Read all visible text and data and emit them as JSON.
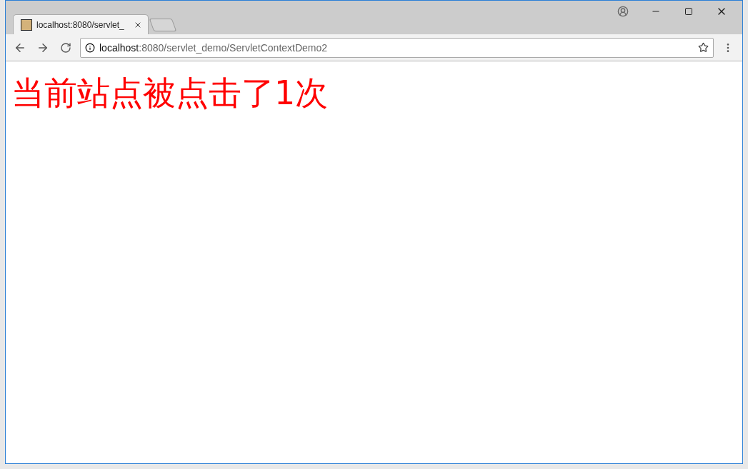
{
  "tabs": [
    {
      "title": "localhost:8080/servlet_",
      "selected": true
    }
  ],
  "address_bar": {
    "host": "localhost",
    "path": ":8080/servlet_demo/ServletContextDemo2"
  },
  "page": {
    "heading": "当前站点被点击了1次"
  }
}
